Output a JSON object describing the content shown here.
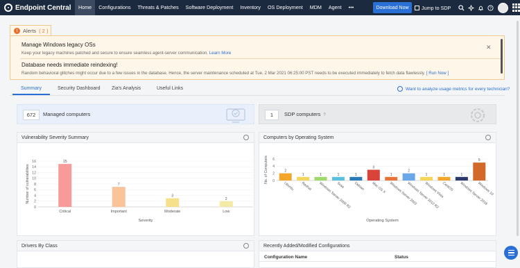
{
  "topbar": {
    "logo": "Endpoint Central",
    "nav": [
      "Home",
      "Configurations",
      "Threats & Patches",
      "Software Deployment",
      "Inventory",
      "OS Deployment",
      "MDM",
      "Agent",
      "•••"
    ],
    "download_label": "Download Now",
    "jump_label": "Jump to SDP"
  },
  "alerts": {
    "tab_label": "Alerts",
    "count": "( 2 )",
    "items": [
      {
        "title": "Manage Windows legacy OSs",
        "desc": "Keep your legacy machines patched and secure to ensure seamless agent-server communication.",
        "link": "Learn More"
      },
      {
        "title": "Database needs immediate reindexing!",
        "desc": "Random behavioral glitches might occur due to a few issues in the database. Hence, the server maintenance scheduled at Tue, 2 Mar 2021 06:25:00 PST needs to be executed immediately to fetch data flawlessly.",
        "link": "[ Run Now ]"
      }
    ]
  },
  "tabs": {
    "items": [
      "Summary",
      "Security Dashboard",
      "Zia's Analysis",
      "Useful Links"
    ],
    "usage_link": "Want to analyze usage metrics for every technician?"
  },
  "summary": {
    "managed_count": "672",
    "managed_label": "Managed computers",
    "sdp_count": "1",
    "sdp_label": "SDP computers",
    "sdp_help": "?"
  },
  "panels": {
    "vuln_title": "Vulnerability Severity Summary",
    "os_title": "Computers by Operating System",
    "drivers_title": "Drivers By Class",
    "configs_title": "Recently Added/Modified Configurations",
    "configs_columns": [
      "Configuration Name",
      "Status"
    ]
  },
  "colors": {
    "topbar": "#1b2a3f",
    "accent": "#2a6fd6",
    "alert_bg": "#fff6ea"
  },
  "chart_data": [
    {
      "type": "bar",
      "title": "Vulnerability Severity Summary",
      "xlabel": "Severity",
      "ylabel": "Number of vulnerabilities",
      "categories": [
        "Critical",
        "Important",
        "Moderate",
        "Low"
      ],
      "values": [
        15,
        7,
        3,
        2
      ],
      "colors": [
        "#f79a9a",
        "#f9c49a",
        "#f7e08c",
        "#f5e9a6"
      ],
      "ylim": [
        0,
        16
      ],
      "yticks": [
        0,
        2,
        4,
        6,
        8,
        10,
        12,
        14,
        16
      ]
    },
    {
      "type": "bar",
      "title": "Computers by Operating System",
      "xlabel": "Operating System",
      "ylabel": "No. of Computers",
      "categories": [
        "Ubuntu",
        "Redhat",
        "Windows Server 2008 R2",
        "Suse",
        "Debian",
        "Mac OS X",
        "Windows Server 2022",
        "Windows Server 2012 R2",
        "Windows Vista",
        "CentOS",
        "Windows Server 2016",
        "Windows 10"
      ],
      "values": [
        2,
        1,
        1,
        1,
        1,
        3,
        1,
        2,
        1,
        1,
        1,
        5
      ],
      "colors": [
        "#f4a62a",
        "#f3d65b",
        "#9fd86b",
        "#5bc0de",
        "#2b7bb9",
        "#d9443a",
        "#e8733a",
        "#6aa7e8",
        "#f3d65b",
        "#f4a62a",
        "#2b3a6b",
        "#d2692a"
      ],
      "ylim": [
        0,
        6
      ],
      "yticks": [
        0,
        2,
        4,
        6
      ]
    }
  ]
}
